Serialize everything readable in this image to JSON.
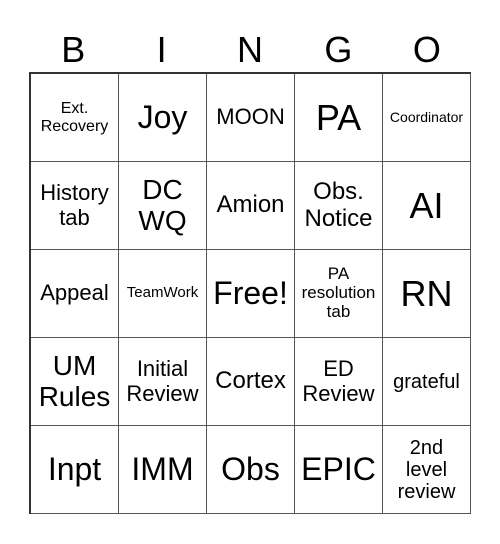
{
  "header": [
    "B",
    "I",
    "N",
    "G",
    "O"
  ],
  "cells": [
    [
      "Ext.\nRecovery",
      "Joy",
      "MOON",
      "PA",
      "Coordinator"
    ],
    [
      "History\ntab",
      "DC\nWQ",
      "Amion",
      "Obs.\nNotice",
      "AI"
    ],
    [
      "Appeal",
      "TeamWork",
      "Free!",
      "PA\nresolution\ntab",
      "RN"
    ],
    [
      "UM\nRules",
      "Initial\nReview",
      "Cortex",
      "ED\nReview",
      "grateful"
    ],
    [
      "Inpt",
      "IMM",
      "Obs",
      "EPIC",
      "2nd\nlevel\nreview"
    ]
  ]
}
